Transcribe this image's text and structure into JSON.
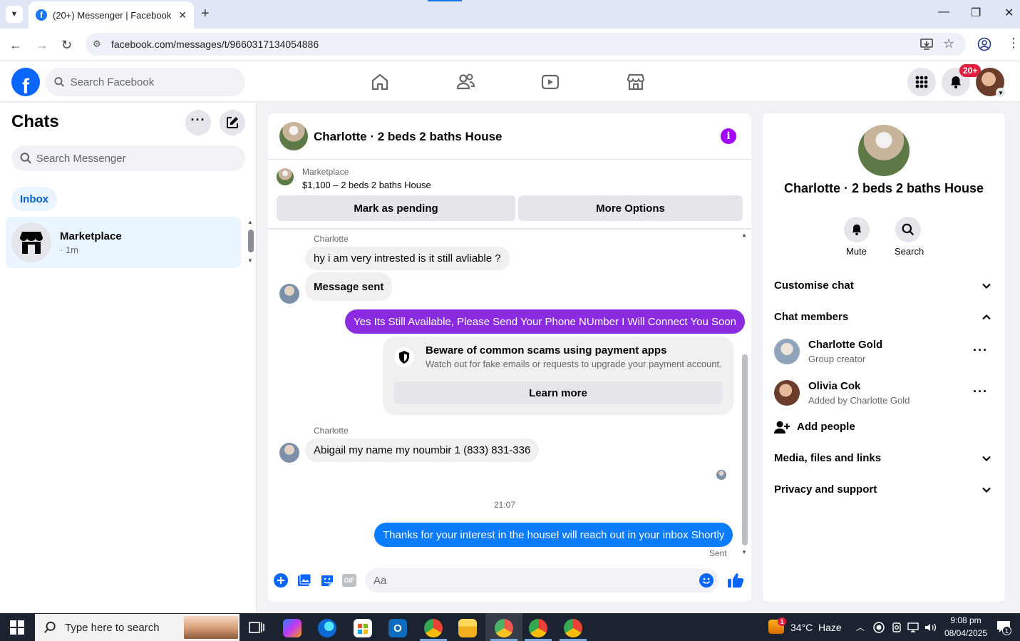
{
  "browser": {
    "tab_title": "(20+) Messenger | Facebook",
    "url": "facebook.com/messages/t/9660317134054886"
  },
  "fb": {
    "search_placeholder": "Search Facebook",
    "notification_badge": "20+"
  },
  "chats": {
    "title": "Chats",
    "search_placeholder": "Search Messenger",
    "inbox_label": "Inbox",
    "items": [
      {
        "name": "Marketplace",
        "meta": "· 1m"
      }
    ]
  },
  "conversation": {
    "title": "Charlotte · 2 beds 2 baths House",
    "listing_source": "Marketplace",
    "listing_price": "$1,100 – 2 beds 2 baths House",
    "mark_pending_label": "Mark as pending",
    "more_options_label": "More Options",
    "messages": [
      {
        "sender": "Charlotte",
        "text": "hy i am very intrested is it still avliable ?"
      },
      {
        "text": "Message sent"
      },
      {
        "text": "Yes Its Still Available, Please Send Your Phone NUmber I Will Connect You Soon"
      },
      {
        "sender": "Charlotte",
        "text": "Abigail my name my noumbir 1 (833) 831-336"
      },
      {
        "text": "Thanks for your interest in the houseI will reach out in your inbox Shortly"
      }
    ],
    "scam_notice": {
      "title": "Beware of common scams using payment apps",
      "description": "Watch out for fake emails or requests to upgrade your payment account.",
      "button": "Learn more"
    },
    "timestamp": "21:07",
    "sent_status": "Sent",
    "composer_placeholder": "Aa",
    "colors": {
      "purple_bubble": "#8a2be2",
      "blue_bubble": "#0a7cff"
    }
  },
  "info_panel": {
    "name": "Charlotte · 2 beds 2 baths House",
    "actions": [
      {
        "label": "Mute"
      },
      {
        "label": "Search"
      }
    ],
    "sections": {
      "customise": "Customise chat",
      "members": "Chat members",
      "add_people": "Add people",
      "media": "Media, files and links",
      "privacy": "Privacy and support"
    },
    "members": [
      {
        "name": "Charlotte Gold",
        "role": "Group creator"
      },
      {
        "name": "Olivia Cok",
        "role": "Added by Charlotte Gold"
      }
    ]
  },
  "taskbar": {
    "search_placeholder": "Type here to search",
    "weather_temp": "34°C",
    "weather_desc": "Haze",
    "time": "9:08 pm",
    "date": "08/04/2025",
    "weather_badge": "1",
    "notif_count": "1"
  }
}
